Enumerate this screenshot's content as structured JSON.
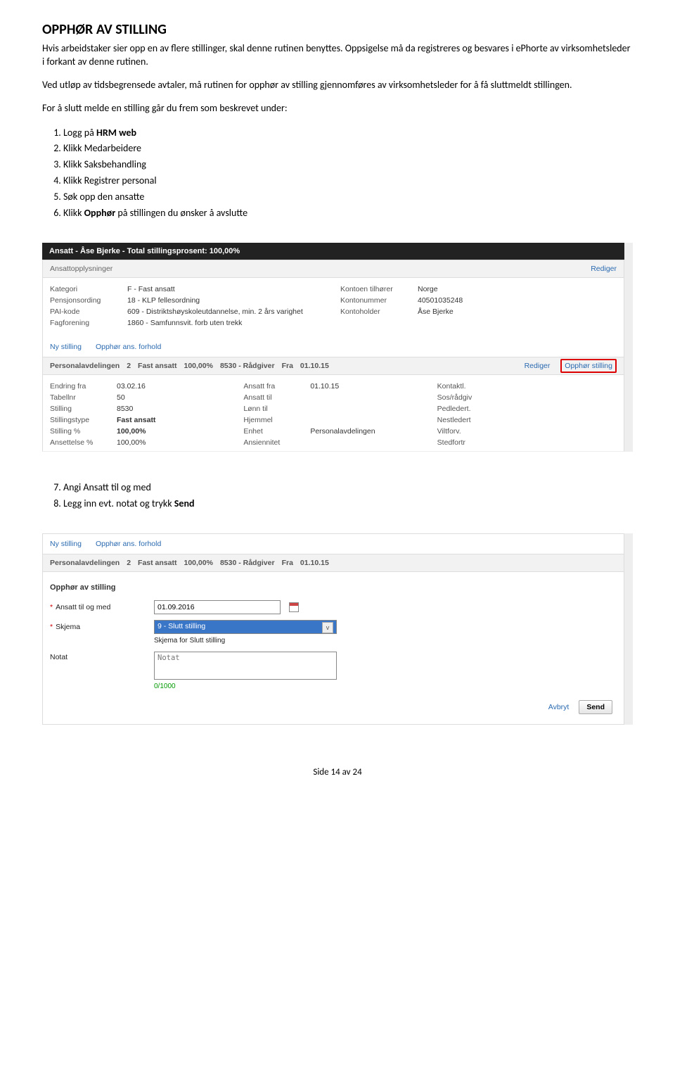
{
  "doc": {
    "title": "OPPHØR AV STILLING",
    "p1": "Hvis arbeidstaker sier opp en av flere stillinger, skal denne rutinen benyttes. Oppsigelse må da registreres og besvares i ePhorte av virksomhetsleder i forkant av denne rutinen.",
    "p2": "Ved utløp av tidsbegrensede avtaler, må rutinen for opphør av stilling gjennomføres av virksomhetsleder for å få sluttmeldt stillingen.",
    "p3": "For å slutt melde en stilling går du frem som beskrevet under:",
    "steps": [
      {
        "pre": "Logg på ",
        "bold": "HRM web",
        "post": ""
      },
      {
        "pre": "Klikk Medarbeidere",
        "bold": "",
        "post": ""
      },
      {
        "pre": "Klikk Saksbehandling",
        "bold": "",
        "post": ""
      },
      {
        "pre": "Klikk Registrer personal",
        "bold": "",
        "post": ""
      },
      {
        "pre": "Søk opp den ansatte",
        "bold": "",
        "post": ""
      },
      {
        "pre": "Klikk ",
        "bold": "Opphør",
        "post": " på stillingen du ønsker å avslutte"
      }
    ],
    "steps2": [
      "Angi Ansatt til og med",
      "Legg inn evt. notat og trykk "
    ],
    "steps2_bold": "Send",
    "page_footer": "Side 14 av 24"
  },
  "shot1": {
    "title_bar": "Ansatt - Åse Bjerke - Total stillingsprosent: 100,00%",
    "section_header": "Ansattopplysninger",
    "rediger": "Rediger",
    "left": {
      "kategori_l": "Kategori",
      "kategori_v": "F - Fast ansatt",
      "pensjon_l": "Pensjonsording",
      "pensjon_v": "18 - KLP fellesordning",
      "pai_l": "PAI-kode",
      "pai_v": "609 - Distriktshøyskoleutdannelse, min. 2 års varighet",
      "fag_l": "Fagforening",
      "fag_v": "1860 - Samfunnsvit. forb uten trekk"
    },
    "right": {
      "konto_til_l": "Kontoen tilhører",
      "konto_til_v": "Norge",
      "kontonr_l": "Kontonummer",
      "kontonr_v": "40501035248",
      "kontoh_l": "Kontoholder",
      "kontoh_v": "Åse Bjerke"
    },
    "link_ny": "Ny stilling",
    "link_opp": "Opphør ans. forhold",
    "stilling_header_parts": [
      "Personalavdelingen",
      "2",
      "Fast ansatt",
      "100,00%",
      "8530 - Rådgiver",
      "Fra",
      "01.10.15"
    ],
    "opphor_stilling": "Opphør stilling",
    "col1": {
      "endring_l": "Endring fra",
      "endring_v": "03.02.16",
      "tabell_l": "Tabellnr",
      "tabell_v": "50",
      "stilling_l": "Stilling",
      "stilling_v": "8530",
      "stype_l": "Stillingstype",
      "stype_v": "Fast ansatt",
      "spct_l": "Stilling %",
      "spct_v": "100,00%",
      "apct_l": "Ansettelse %",
      "apct_v": "100,00%"
    },
    "col2": {
      "afra_l": "Ansatt fra",
      "afra_v": "01.10.15",
      "atil_l": "Ansatt til",
      "atil_v": "",
      "lonn_l": "Lønn til",
      "lonn_v": "",
      "hjemmel_l": "Hjemmel",
      "hjemmel_v": "",
      "enhet_l": "Enhet",
      "enhet_v": "Personalavdelingen",
      "ans_l": "Ansiennitet",
      "ans_v": ""
    },
    "col3": {
      "k1": "Kontaktl.",
      "k2": "Sos/rådgiv",
      "k3": "Pedledert.",
      "k4": "Nestledert",
      "k5": "Viltforv.",
      "k6": "Stedfortr"
    }
  },
  "shot2": {
    "link_ny": "Ny stilling",
    "link_opp": "Opphør ans. forhold",
    "stilling_header_parts": [
      "Personalavdelingen",
      "2",
      "Fast ansatt",
      "100,00%",
      "8530 - Rådgiver",
      "Fra",
      "01.10.15"
    ],
    "form_title": "Opphør av stilling",
    "f_ansatt_l": "Ansatt til og med",
    "f_ansatt_v": "01.09.2016",
    "f_skjema_l": "Skjema",
    "f_skjema_v": "9 - Slutt stilling",
    "f_skjema_sub": "Skjema for Slutt stilling",
    "f_notat_l": "Notat",
    "f_notat_ph": "Notat",
    "counter": "0/1000",
    "avbryt": "Avbryt",
    "send": "Send"
  }
}
